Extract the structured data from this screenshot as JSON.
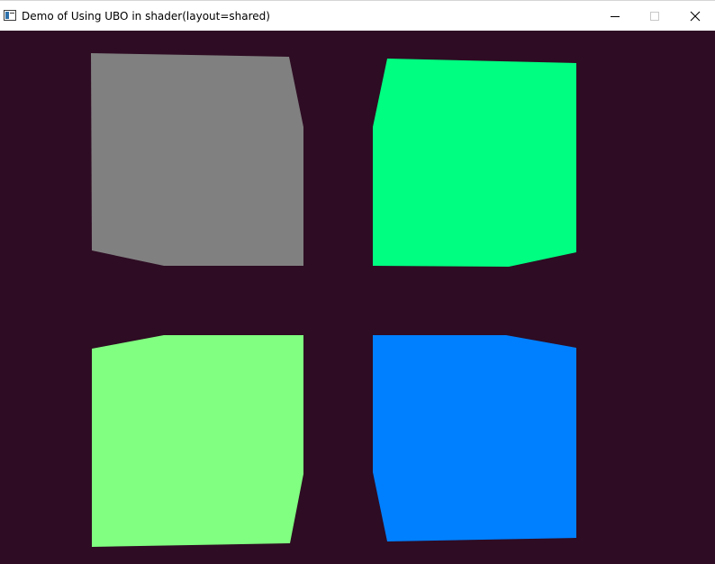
{
  "window": {
    "title": "Demo of Using UBO in shader(layout=shared)",
    "icon": "app-window-icon",
    "controls": {
      "minimize_icon": "minimize-icon",
      "maximize_icon": "maximize-icon",
      "close_icon": "close-icon"
    }
  },
  "viewport": {
    "clear_color": "#2e0c23",
    "cubes": [
      {
        "name": "top-left-cube",
        "color": "#808080"
      },
      {
        "name": "top-right-cube",
        "color": "#00ff80"
      },
      {
        "name": "bottom-left-cube",
        "color": "#80ff80"
      },
      {
        "name": "bottom-right-cube",
        "color": "#0080ff"
      }
    ]
  }
}
